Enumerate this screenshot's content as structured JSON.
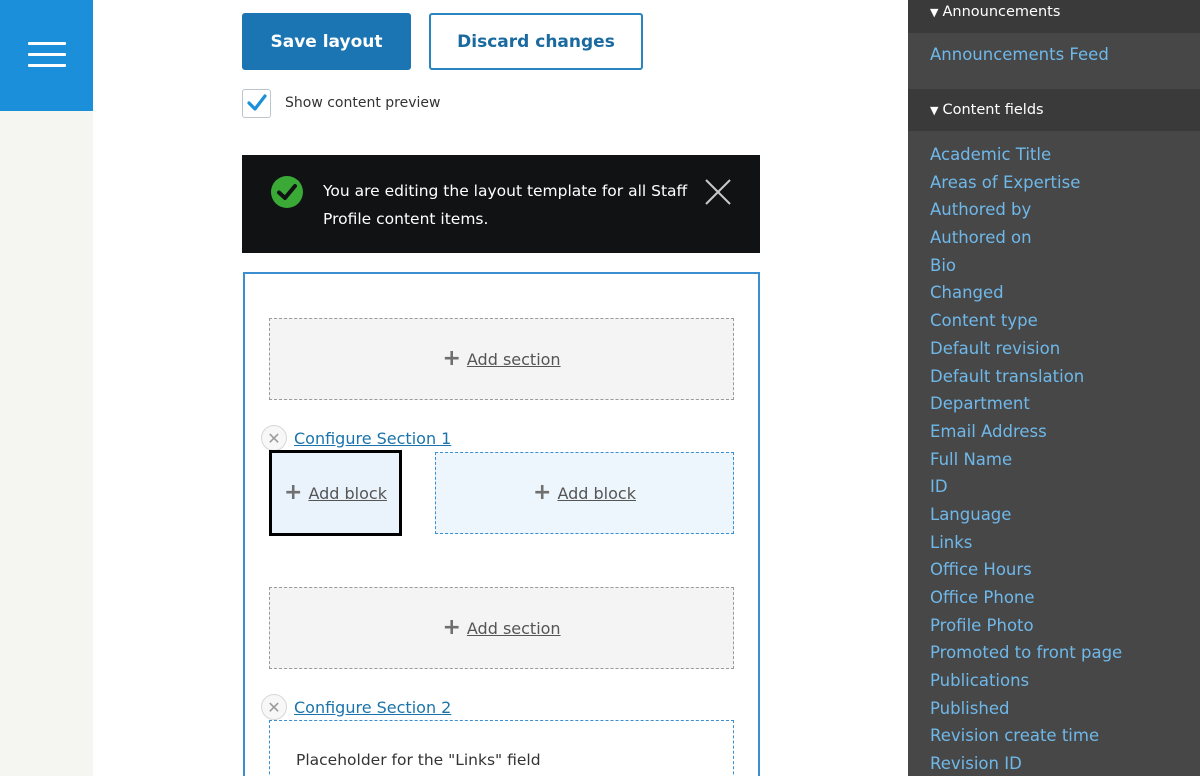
{
  "toolbar": {
    "save_label": "Save layout",
    "discard_label": "Discard changes",
    "preview_label": "Show content preview",
    "preview_checked": true
  },
  "status": {
    "message": "You are editing the layout template for all Staff Profile content items."
  },
  "builder": {
    "add_section_label": "Add section",
    "add_block_label": "Add block",
    "sections": [
      {
        "configure_label": "Configure Section 1"
      },
      {
        "configure_label": "Configure Section 2"
      }
    ],
    "placeholder_text": "Placeholder for the \"Links\" field"
  },
  "sidebar": {
    "announcements_heading": "Announcements",
    "announcements_feed": "Announcements Feed",
    "content_fields_heading": "Content fields",
    "fields": [
      "Academic Title",
      "Areas of Expertise",
      "Authored by",
      "Authored on",
      "Bio",
      "Changed",
      "Content type",
      "Default revision",
      "Default translation",
      "Department",
      "Email Address",
      "Full Name",
      "ID",
      "Language",
      "Links",
      "Office Hours",
      "Office Phone",
      "Profile Photo",
      "Promoted to front page",
      "Publications",
      "Published",
      "Revision create time",
      "Revision ID"
    ]
  },
  "colors": {
    "accent": "#1b8fd9",
    "primary_button": "#1a75b2",
    "status_bg": "#101214",
    "status_check": "#3aa935",
    "sidebar_bg": "#474747",
    "sidebar_link": "#6fb8ea"
  },
  "icons": {
    "menu": "hamburger-icon",
    "check": "checkmark-icon",
    "status": "check-circle-icon",
    "close": "close-icon",
    "add": "plus-icon",
    "remove": "remove-x-icon",
    "collapse": "triangle-down-icon"
  }
}
